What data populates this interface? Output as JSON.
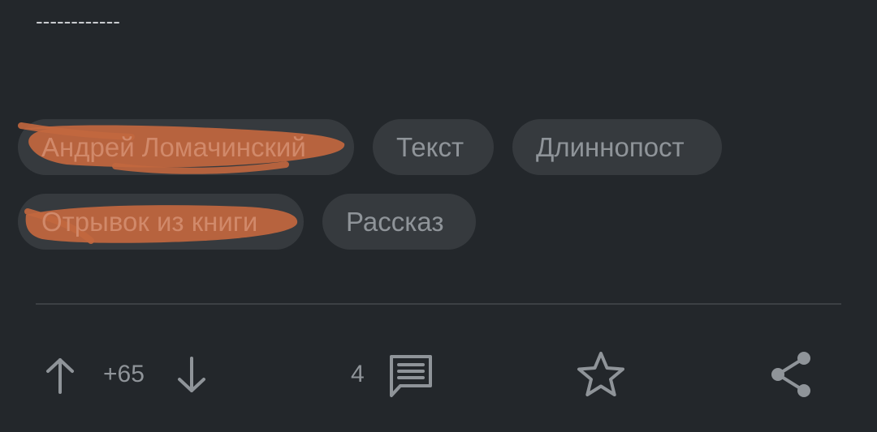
{
  "separator_text": "------------",
  "tags": {
    "row1": [
      {
        "label": "Андрей Ломачинский"
      },
      {
        "label": "Текст"
      },
      {
        "label": "Длиннопост"
      }
    ],
    "row2": [
      {
        "label": "Отрывок из книги"
      },
      {
        "label": "Рассказ"
      }
    ]
  },
  "actions": {
    "rating": "+65",
    "comments_count": "4"
  },
  "colors": {
    "background": "#23272b",
    "chip": "#363a3e",
    "text_muted": "#8f9499",
    "scribble": "#c2673e"
  }
}
